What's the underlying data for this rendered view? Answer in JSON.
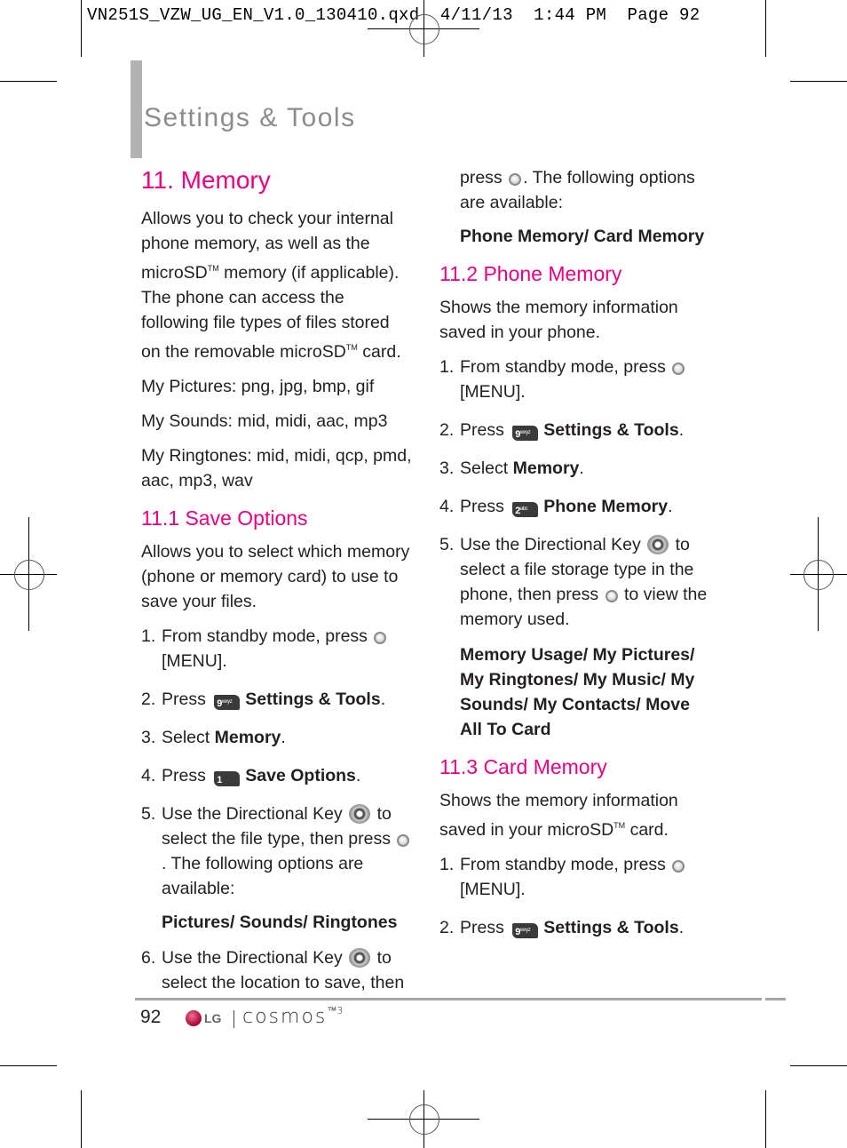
{
  "slug": "VN251S_VZW_UG_EN_V1.0_130410.qxd  4/11/13  1:44 PM  Page 92",
  "colors": {
    "accent": "#e6007e",
    "section_title": "#8c8c8c",
    "rule": "#a6a6a6"
  },
  "section_title": "Settings & Tools",
  "left": {
    "heading": "11. Memory",
    "intro_1": "Allows you to check your internal phone memory, as well as the microSD",
    "intro_tm1": "TM",
    "intro_2": " memory (if applicable). The phone can access the following file types of files stored on the removable microSD",
    "intro_tm2": "TM",
    "intro_3": " card.",
    "file_types": [
      "My Pictures: png, jpg, bmp, gif",
      "My Sounds: mid, midi, aac, mp3",
      "My Ringtones: mid, midi, qcp, pmd, aac, mp3, wav"
    ],
    "save_options": {
      "heading": "11.1 Save Options",
      "intro": "Allows you to select which memory (phone or memory card) to use to save your files.",
      "steps": [
        {
          "num": "1.",
          "pre": "From standby mode, press",
          "post": "[MENU]."
        },
        {
          "num": "2.",
          "pre": "Press",
          "key": "9",
          "key_sub": "wxyz",
          "bold": "Settings & Tools",
          "post": "."
        },
        {
          "num": "3.",
          "pre": "Select",
          "bold": "Memory",
          "post": "."
        },
        {
          "num": "4.",
          "pre": "Press",
          "key": "1",
          "key_sub": "",
          "bold": "Save Options",
          "post": "."
        },
        {
          "num": "5.",
          "pre": "Use the Directional Key",
          "mid": "to select the file type, then press",
          "post": ". The following options are available:"
        },
        {
          "num": "6.",
          "pre": "Use the Directional Key",
          "mid": "to select the location to save, then"
        }
      ],
      "options_5": "Pictures/ Sounds/ Ringtones"
    }
  },
  "right": {
    "cont_pre": "press",
    "cont_post": ". The following options are available:",
    "options_6": "Phone Memory/ Card Memory",
    "phone_memory": {
      "heading": "11.2 Phone Memory",
      "intro": "Shows the memory information saved in your phone.",
      "steps": [
        {
          "num": "1.",
          "pre": "From standby mode, press",
          "post": "[MENU]."
        },
        {
          "num": "2.",
          "pre": "Press",
          "key": "9",
          "key_sub": "wxyz",
          "bold": "Settings & Tools",
          "post": "."
        },
        {
          "num": "3.",
          "pre": "Select",
          "bold": "Memory",
          "post": "."
        },
        {
          "num": "4.",
          "pre": "Press",
          "key": "2",
          "key_sub": "abc",
          "bold": "Phone Memory",
          "post": "."
        },
        {
          "num": "5.",
          "pre": "Use the Directional Key",
          "mid": "to select a file storage type in the phone, then press",
          "post": "to view the memory used."
        }
      ],
      "options_5": "Memory Usage/ My Pictures/ My Ringtones/ My Music/ My Sounds/ My Contacts/ Move All To Card"
    },
    "card_memory": {
      "heading": "11.3 Card Memory",
      "intro_1": "Shows the memory information saved in your microSD",
      "intro_tm": "TM",
      "intro_2": " card.",
      "steps": [
        {
          "num": "1.",
          "pre": "From standby mode, press",
          "post": "[MENU]."
        },
        {
          "num": "2.",
          "pre": "Press",
          "key": "9",
          "key_sub": "wxyz",
          "bold": "Settings & Tools",
          "post": "."
        }
      ]
    }
  },
  "footer": {
    "page_number": "92",
    "lg_text": "LG",
    "brand": "cosmos",
    "brand_sup": "™3"
  }
}
